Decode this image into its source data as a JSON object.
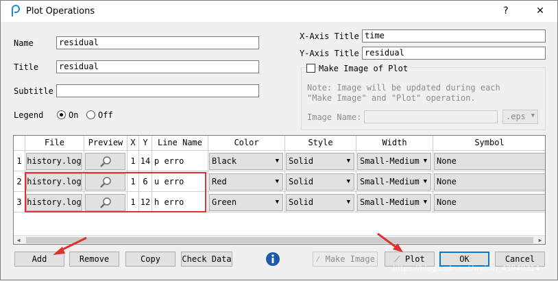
{
  "window": {
    "title": "Plot Operations",
    "help_label": "?",
    "close_label": "✕"
  },
  "form": {
    "name_label": "Name",
    "name_value": "residual",
    "title_label": "Title",
    "title_value": "residual",
    "subtitle_label": "Subtitle",
    "subtitle_value": "",
    "legend_label": "Legend",
    "legend_on": "On",
    "legend_off": "Off",
    "legend_selected": "On",
    "xaxis_label": "X-Axis Title",
    "xaxis_value": "time",
    "yaxis_label": "Y-Axis Title",
    "yaxis_value": "residual"
  },
  "image": {
    "checkbox_label": "Make Image of Plot",
    "checked": false,
    "note_line1": "Note: Image will be updated during each",
    "note_line2": "\"Make Image\" and \"Plot\" operation.",
    "name_label": "Image Name:",
    "name_value": "",
    "format": ".eps"
  },
  "table": {
    "headers": [
      "File",
      "Preview",
      "X",
      "Y",
      "Line Name",
      "Color",
      "Style",
      "Width",
      "Symbol"
    ],
    "rows": [
      {
        "num": "1",
        "file": "history.log",
        "x": "1",
        "y": "14",
        "line_name": "p erro",
        "color": "Black",
        "style": "Solid",
        "width": "Small-Medium",
        "symbol": "None"
      },
      {
        "num": "2",
        "file": "history.log",
        "x": "1",
        "y": "6",
        "line_name": "u erro",
        "color": "Red",
        "style": "Solid",
        "width": "Small-Medium",
        "symbol": "None"
      },
      {
        "num": "3",
        "file": "history.log",
        "x": "1",
        "y": "12",
        "line_name": "h erro",
        "color": "Green",
        "style": "Solid",
        "width": "Small-Medium",
        "symbol": "None"
      }
    ]
  },
  "buttons": {
    "add": "Add",
    "remove": "Remove",
    "copy": "Copy",
    "check_data": "Check Data",
    "make_image": "Make Image",
    "plot": "Plot",
    "ok": "OK",
    "cancel": "Cancel"
  },
  "watermark": "https://blog.csdn.net/weixin_43940314",
  "colors": {
    "accent": "#0078d7",
    "highlight": "#e0302f",
    "info": "#1e5aa8"
  }
}
